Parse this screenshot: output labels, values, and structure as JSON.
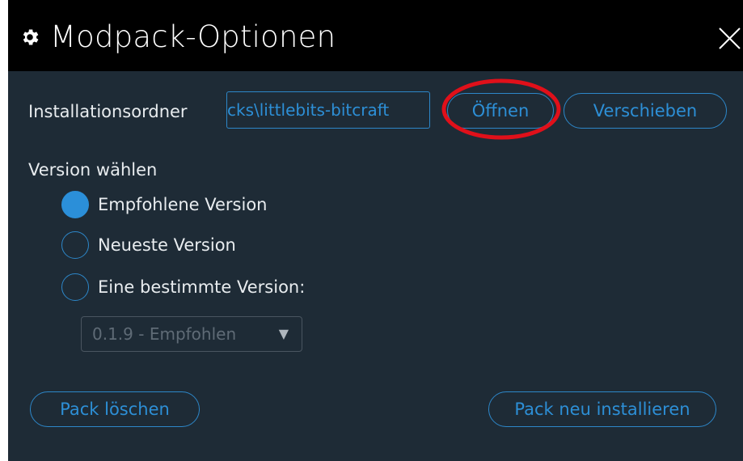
{
  "dialog": {
    "title": "Modpack-Optionen",
    "title_icon": "gear-icon",
    "close_icon": "close-icon"
  },
  "install_folder": {
    "label": "Installationsordner",
    "path_value": "cks\\littlebits-bitcraft",
    "open_label": "Öffnen",
    "move_label": "Verschieben"
  },
  "version": {
    "heading": "Version wählen",
    "options": [
      {
        "label": "Empfohlene Version",
        "checked": true
      },
      {
        "label": "Neueste Version",
        "checked": false
      },
      {
        "label": "Eine bestimmte Version:",
        "checked": false
      }
    ],
    "select_value": "0.1.9 - Empfohlen",
    "select_arrow": "▼"
  },
  "footer": {
    "delete_label": "Pack löschen",
    "reinstall_label": "Pack neu installieren"
  },
  "colors": {
    "background": "#1e2b36",
    "titlebar": "#000000",
    "accent": "#2d8fd6",
    "highlight": "#e0101a"
  }
}
